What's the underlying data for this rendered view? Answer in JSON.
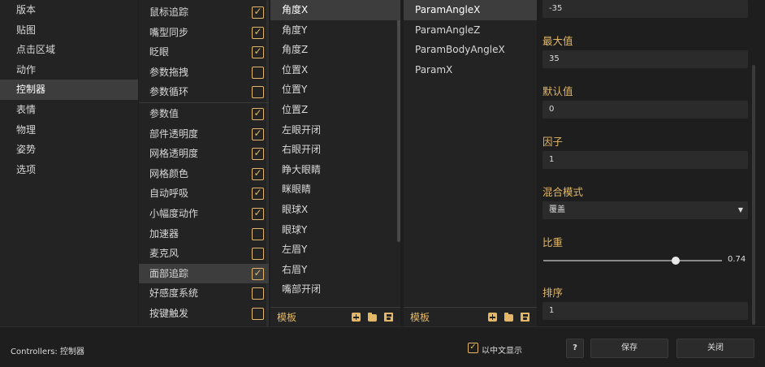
{
  "categories": {
    "items": [
      "版本",
      "贴图",
      "点击区域",
      "动作",
      "控制器",
      "表情",
      "物理",
      "姿势",
      "选项"
    ],
    "selected_index": 4
  },
  "features": {
    "items": [
      {
        "label": "鼠标追踪",
        "checked": true
      },
      {
        "label": "嘴型同步",
        "checked": true
      },
      {
        "label": "眨眼",
        "checked": true
      },
      {
        "label": "参数拖拽",
        "checked": false
      },
      {
        "label": "参数循环",
        "checked": false
      },
      {
        "label": "参数值",
        "checked": true
      },
      {
        "label": "部件透明度",
        "checked": true
      },
      {
        "label": "网格透明度",
        "checked": true
      },
      {
        "label": "网格颜色",
        "checked": true
      },
      {
        "label": "自动呼吸",
        "checked": true
      },
      {
        "label": "小幅度动作",
        "checked": true
      },
      {
        "label": "加速器",
        "checked": false
      },
      {
        "label": "麦克风",
        "checked": false
      },
      {
        "label": "面部追踪",
        "checked": true
      },
      {
        "label": "好感度系统",
        "checked": false
      },
      {
        "label": "按键触发",
        "checked": false
      }
    ],
    "selected_index": 13
  },
  "face_params": {
    "items": [
      "角度X",
      "角度Y",
      "角度Z",
      "位置X",
      "位置Y",
      "位置Z",
      "左眼开闭",
      "右眼开闭",
      "睁大眼睛",
      "眯眼睛",
      "眼球X",
      "眼球Y",
      "左眉Y",
      "右眉Y",
      "嘴部开闭"
    ],
    "selected_index": 0,
    "footer_label": "模板"
  },
  "model_params": {
    "items": [
      "ParamAngleX",
      "ParamAngleZ",
      "ParamBodyAngleX",
      "ParamX"
    ],
    "selected_index": 0,
    "footer_label": "模板"
  },
  "properties": {
    "min_value": "-35",
    "max_label": "最大值",
    "max_value": "35",
    "default_label": "默认值",
    "default_value": "0",
    "factor_label": "因子",
    "factor_value": "1",
    "blend_label": "混合模式",
    "blend_value": "覆盖",
    "weight_label": "比重",
    "weight_value": "0.74",
    "weight_fraction": 0.74,
    "order_label": "排序",
    "order_value": "1"
  },
  "bottom": {
    "status": "Controllers: 控制器",
    "chinese_label": "以中文显示",
    "chinese_checked": true,
    "help_label": "?",
    "save_label": "保存",
    "close_label": "关闭"
  },
  "icons": [
    "check-icon",
    "plus-icon",
    "folder-icon",
    "save-icon",
    "caret-down-icon",
    "help-icon"
  ],
  "colors": {
    "accent": "#e3b766",
    "background": "#1e1e1e",
    "panel": "#232323",
    "selected": "#3d3d3d"
  }
}
